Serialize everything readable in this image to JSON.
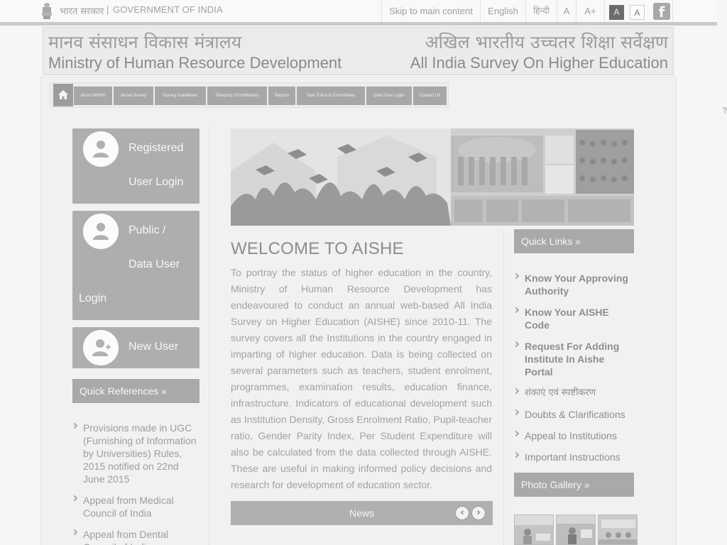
{
  "topbar": {
    "gov_hindi": "भारत सरकार",
    "gov_separator": "|",
    "gov_english": "GOVERNMENT OF INDIA",
    "skip_link": "Skip to main content",
    "lang_english": "English",
    "lang_hindi": "हिन्दी",
    "font_normal": "A",
    "font_larger": "A+",
    "contrast_dark": "A",
    "contrast_light": "A",
    "facebook_icon": "f"
  },
  "banner": {
    "ministry_hindi": "मानव संसाधन विकास मंत्रालय",
    "ministry_english": "Ministry of Human Resource Development",
    "survey_hindi": "अखिल भारतीय उच्चतर शिक्षा सर्वेक्षण",
    "survey_english": "All India Survey On Higher Education"
  },
  "nav": {
    "items": [
      "About MHRD",
      "About Survey",
      "Survey Guidelines",
      "Directory of Institutions",
      "Reports",
      "Task Force & Committees",
      "Data User Login",
      "Contact Us"
    ]
  },
  "edge_glyph": "'N",
  "login": {
    "registered_line1": "Registered",
    "registered_line2": "User Login",
    "public_line1": "Public /",
    "public_line2": "Data User",
    "public_line3": "Login",
    "new_user": "New User"
  },
  "quick_references": {
    "heading": "Quick References »",
    "items": [
      "Provisions made in UGC (Furnishing of Information by Universities) Rules, 2015 notified on 22nd June 2015",
      "Appeal from Medical Council of India",
      "Appeal from Dental Council of India"
    ]
  },
  "welcome": {
    "title": "WELCOME TO AISHE",
    "body": "To portray the status of higher education in the country, Ministry of Human Resource Development has endeavoured to conduct an annual web-based All India Survey on Higher Education (AISHE) since 2010-11. The survey covers all the Institutions in the country engaged in imparting of higher education. Data is being collected on several parameters such as teachers, student enrolment, programmes, examination results, education finance, infrastructure. Indicators of educational development such as Institution Density, Gross Enrolment Ratio, Pupil-teacher ratio, Gender Parity Index, Per Student Expenditure will also be calculated from the data collected through AISHE. These are useful in making informed policy decisions and research for development of education sector."
  },
  "news": {
    "label": "News",
    "prev": "‹",
    "next": "›"
  },
  "quick_links": {
    "heading": "Quick Links »",
    "items": [
      "Know Your Approving Authority",
      "Know Your AISHE Code",
      "Request For Adding Institute In Aishe Portal",
      "शंकाएं एवं स्पष्टीकरण",
      "Doubts & Clarifications",
      "Appeal to Institutions",
      "Important Instructions"
    ]
  },
  "photo_gallery": {
    "heading": "Photo Gallery »"
  }
}
